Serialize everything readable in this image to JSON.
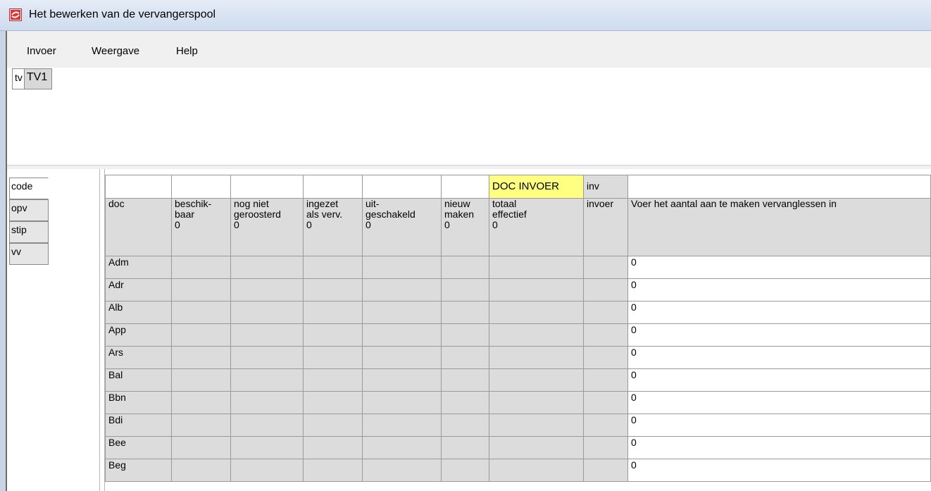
{
  "window": {
    "title": "Het bewerken van de vervangerspool",
    "icon": "app-icon"
  },
  "menu": [
    "Invoer",
    "Weergave",
    "Help"
  ],
  "pool_tab": {
    "code": "tv",
    "name": "TV1"
  },
  "side_tabs": [
    "code",
    "opv",
    "stip",
    "vv"
  ],
  "grid": {
    "top_row": {
      "doc_invoer": "DOC INVOER",
      "inv": "inv"
    },
    "headers": {
      "doc": "doc",
      "beschikbaar": [
        "beschik-",
        "baar",
        "0"
      ],
      "nog_niet": [
        "nog niet",
        "geroosterd",
        "0"
      ],
      "ingezet": [
        "ingezet",
        "als verv.",
        "0"
      ],
      "uitgeschakeld": [
        "uit-",
        "geschakeld",
        "0"
      ],
      "nieuw": [
        "nieuw",
        "maken",
        "0"
      ],
      "totaal": [
        "totaal",
        "effectief",
        "0"
      ],
      "invoer": "invoer",
      "instruction": "Voer het aantal aan te maken vervanglessen in"
    },
    "rows": [
      {
        "doc": "Adm",
        "value": "0"
      },
      {
        "doc": "Adr",
        "value": "0"
      },
      {
        "doc": "Alb",
        "value": "0"
      },
      {
        "doc": "App",
        "value": "0"
      },
      {
        "doc": "Ars",
        "value": "0"
      },
      {
        "doc": "Bal",
        "value": "0"
      },
      {
        "doc": "Bbn",
        "value": "0"
      },
      {
        "doc": "Bdi",
        "value": "0"
      },
      {
        "doc": "Bee",
        "value": "0"
      },
      {
        "doc": "Beg",
        "value": "0"
      }
    ]
  }
}
